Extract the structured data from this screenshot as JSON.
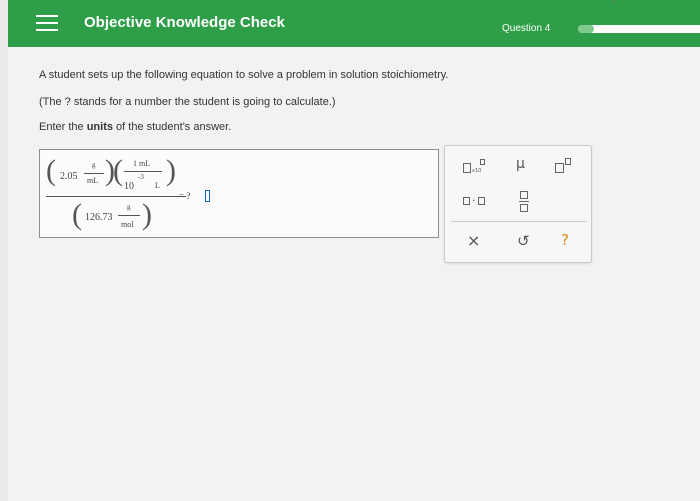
{
  "header": {
    "title": "Objective Knowledge Check",
    "question": "Question 4",
    "progress_fraction": 0.12,
    "corner_text": "~",
    "colors": {
      "bar": "#2e9e48",
      "progress_fill": "#7ec98c"
    }
  },
  "prompt": {
    "line1": "A student sets up the following equation to solve a problem in solution stoichiometry.",
    "line2": "(The ? stands for a number the student is going to calculate.)",
    "line3_before": "Enter the ",
    "line3_bold": "units",
    "line3_after": " of the student's answer."
  },
  "equation": {
    "term1_value": "2.05",
    "term1_num_unit": "g",
    "term1_den_unit": "mL",
    "term2_num": "1 mL",
    "term2_den_base": "10",
    "term2_den_exp": "-3",
    "term2_den_unit": "L",
    "term3_value": "126.73",
    "term3_num_unit": "g",
    "term3_den_unit": "mol",
    "result": "= ?"
  },
  "toolbox": {
    "sci_notation_label": "x10",
    "mu_symbol": "µ",
    "dot_symbol": "·",
    "clear_symbol": "×",
    "undo_symbol": "↺",
    "help_symbol": "?"
  }
}
